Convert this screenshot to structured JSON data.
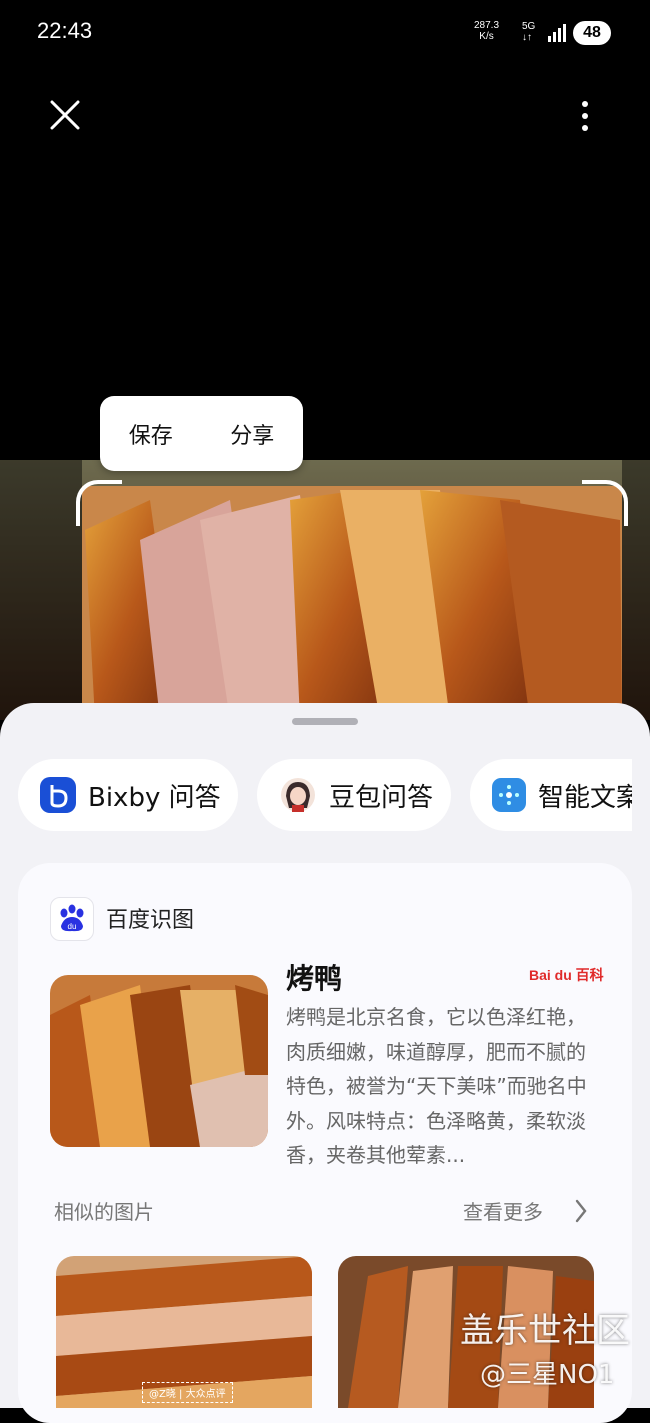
{
  "status_bar": {
    "time": "22:43",
    "net_speed_value": "287.3",
    "net_speed_unit": "K/s",
    "network": "5G",
    "battery": "48"
  },
  "top_bar": {
    "close_icon": "close-icon",
    "more_icon": "more-vertical-icon"
  },
  "context_menu": {
    "save_label": "保存",
    "share_label": "分享"
  },
  "quick_actions": [
    {
      "label": "Bixby 问答",
      "icon": "bixby-icon"
    },
    {
      "label": "豆包问答",
      "icon": "doubao-avatar-icon"
    },
    {
      "label": "智能文案",
      "icon": "smart-copy-icon"
    }
  ],
  "result_card": {
    "source_label": "百度识图",
    "title": "烤鸭",
    "source_logo_text": "Bai du 百科",
    "description": "烤鸭是北京名食，它以色泽红艳，肉质细嫩，味道醇厚，肥而不腻的特色，被誉为“天下美味”而驰名中外。风味特点：色泽略黄，柔软淡香，夹卷其他荤素...",
    "similar_label": "相似的图片",
    "see_more_label": "查看更多",
    "thumb_caption": "@Z晓 | 大众点评"
  },
  "watermark": {
    "line1": "盖乐世社区",
    "line2": "@三星NO1"
  },
  "colors": {
    "accent_bixby": "#1a4fd6",
    "baidu_blue": "#2932e1",
    "baidu_red": "#e02a2a"
  }
}
